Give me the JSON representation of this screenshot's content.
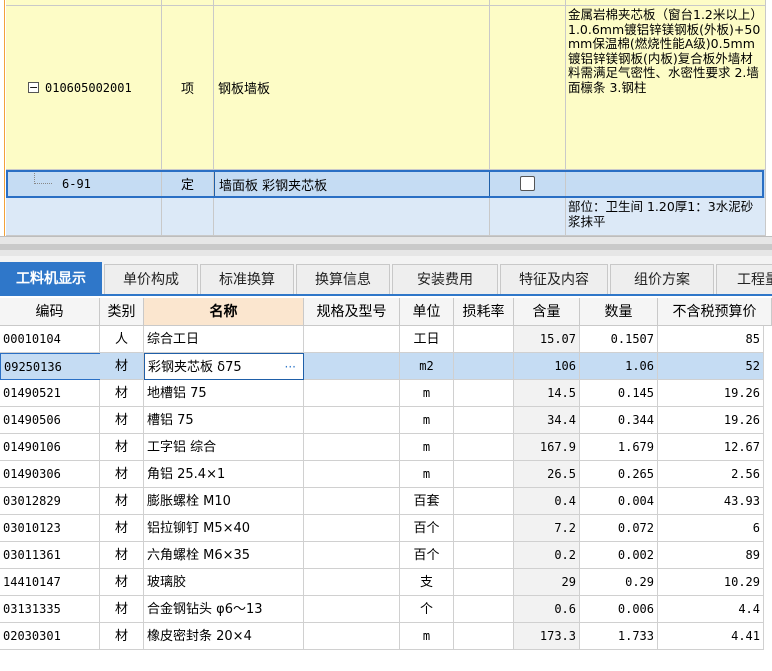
{
  "upper": {
    "item_row": {
      "code": "010605002001",
      "type": "项",
      "name": "钢板墙板",
      "description": "金属岩棉夹芯板（窗台1.2米以上）1.0.6mm镀铝锌镁钢板(外板)+50mm保温棉(燃烧性能A级)0.5mm镀铝锌镁钢板(内板)复合板外墙材料需满足气密性、水密性要求 2.墙面檩条 3.钢柱"
    },
    "quota_row": {
      "code": "6-91",
      "type": "定",
      "name": "墙面板 彩钢夹芯板"
    },
    "next_row": {
      "description": "部位：卫生间 1.20厚1：3水泥砂浆抹平"
    }
  },
  "tabs": [
    {
      "label": "工料机显示",
      "active": true
    },
    {
      "label": "单价构成",
      "active": false
    },
    {
      "label": "标准换算",
      "active": false
    },
    {
      "label": "换算信息",
      "active": false
    },
    {
      "label": "安装费用",
      "active": false
    },
    {
      "label": "特征及内容",
      "active": false
    },
    {
      "label": "组价方案",
      "active": false
    },
    {
      "label": "工程量",
      "active": false
    }
  ],
  "table": {
    "headers": {
      "code": "编码",
      "category": "类别",
      "name": "名称",
      "spec": "规格及型号",
      "unit": "单位",
      "loss": "损耗率",
      "content": "含量",
      "quantity": "数量",
      "price": "不含税预算价"
    },
    "rows": [
      {
        "code": "00010104",
        "category": "人",
        "name": "综合工日",
        "spec": "",
        "unit": "工日",
        "loss": "",
        "content": "15.07",
        "quantity": "0.1507",
        "price": "85"
      },
      {
        "code": "09250136",
        "category": "材",
        "name": "彩钢夹芯板 δ75",
        "spec": "",
        "unit": "m2",
        "loss": "",
        "content": "106",
        "quantity": "1.06",
        "price": "52"
      },
      {
        "code": "01490521",
        "category": "材",
        "name": "地槽铝 75",
        "spec": "",
        "unit": "m",
        "loss": "",
        "content": "14.5",
        "quantity": "0.145",
        "price": "19.26"
      },
      {
        "code": "01490506",
        "category": "材",
        "name": "槽铝 75",
        "spec": "",
        "unit": "m",
        "loss": "",
        "content": "34.4",
        "quantity": "0.344",
        "price": "19.26"
      },
      {
        "code": "01490106",
        "category": "材",
        "name": "工字铝 综合",
        "spec": "",
        "unit": "m",
        "loss": "",
        "content": "167.9",
        "quantity": "1.679",
        "price": "12.67"
      },
      {
        "code": "01490306",
        "category": "材",
        "name": "角铝 25.4×1",
        "spec": "",
        "unit": "m",
        "loss": "",
        "content": "26.5",
        "quantity": "0.265",
        "price": "2.56"
      },
      {
        "code": "03012829",
        "category": "材",
        "name": "膨胀螺栓 M10",
        "spec": "",
        "unit": "百套",
        "loss": "",
        "content": "0.4",
        "quantity": "0.004",
        "price": "43.93"
      },
      {
        "code": "03010123",
        "category": "材",
        "name": "铝拉铆钉 M5×40",
        "spec": "",
        "unit": "百个",
        "loss": "",
        "content": "7.2",
        "quantity": "0.072",
        "price": "6"
      },
      {
        "code": "03011361",
        "category": "材",
        "name": "六角螺栓 M6×35",
        "spec": "",
        "unit": "百个",
        "loss": "",
        "content": "0.2",
        "quantity": "0.002",
        "price": "89"
      },
      {
        "code": "14410147",
        "category": "材",
        "name": "玻璃胶",
        "spec": "",
        "unit": "支",
        "loss": "",
        "content": "29",
        "quantity": "0.29",
        "price": "10.29"
      },
      {
        "code": "03131335",
        "category": "材",
        "name": "合金钢钻头 φ6～13",
        "spec": "",
        "unit": "个",
        "loss": "",
        "content": "0.6",
        "quantity": "0.006",
        "price": "4.4"
      },
      {
        "code": "02030301",
        "category": "材",
        "name": "橡皮密封条 20×4",
        "spec": "",
        "unit": "m",
        "loss": "",
        "content": "173.3",
        "quantity": "1.733",
        "price": "4.41"
      }
    ]
  }
}
